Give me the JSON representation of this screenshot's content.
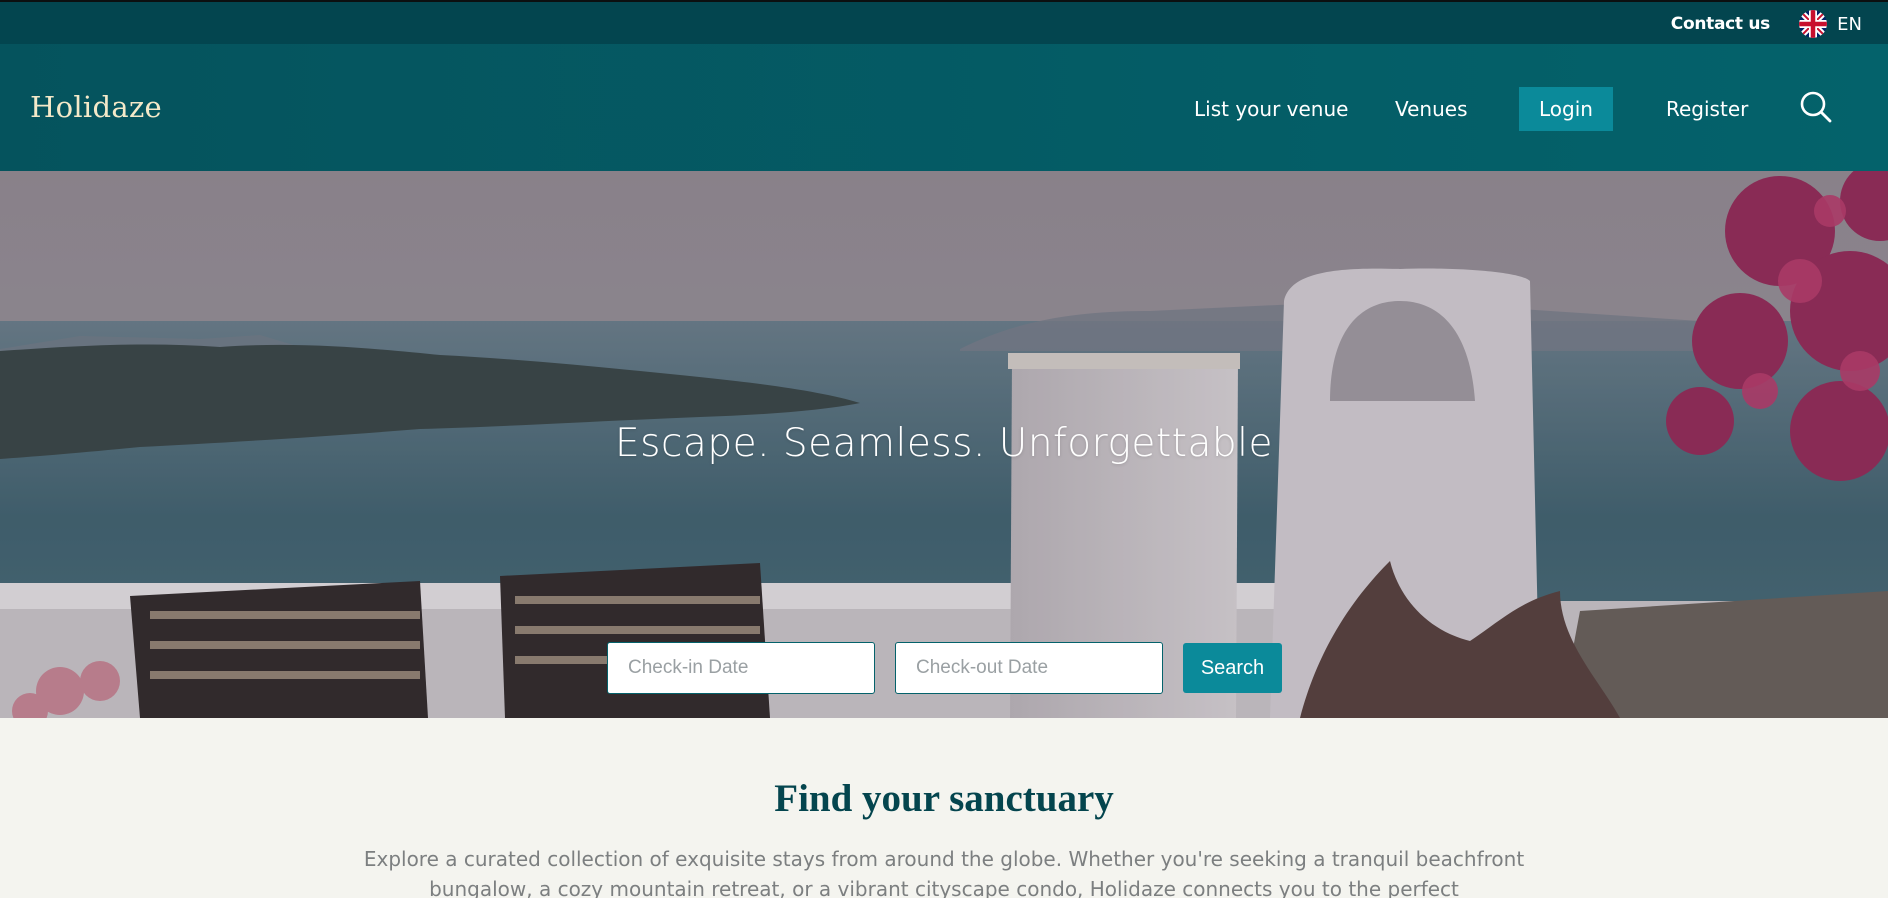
{
  "topbar": {
    "contact_label": "Contact us",
    "language": "EN",
    "language_icon": "uk-flag-icon"
  },
  "nav": {
    "logo": "Holidaze",
    "items": [
      {
        "label": "List your venue"
      },
      {
        "label": "Venues"
      },
      {
        "label": "Login"
      },
      {
        "label": "Register"
      }
    ],
    "search_icon": "search-icon"
  },
  "hero": {
    "title": "Escape. Seamless. Unforgettable",
    "checkin_placeholder": "Check-in Date",
    "checkout_placeholder": "Check-out Date",
    "search_label": "Search"
  },
  "intro": {
    "title": "Find your sanctuary",
    "text": "Explore a curated collection of exquisite stays from around the globe. Whether you're seeking a tranquil beachfront bungalow, a cozy mountain retreat, or a vibrant cityscape condo, Holidaze connects you to the perfect"
  },
  "colors": {
    "topbar_bg": "#03454f",
    "navbar_bg": "#05535d",
    "accent": "#0b8a9a",
    "logo": "#f4e9c9",
    "heading": "#04454e",
    "page_bg": "#f4f4ef"
  }
}
